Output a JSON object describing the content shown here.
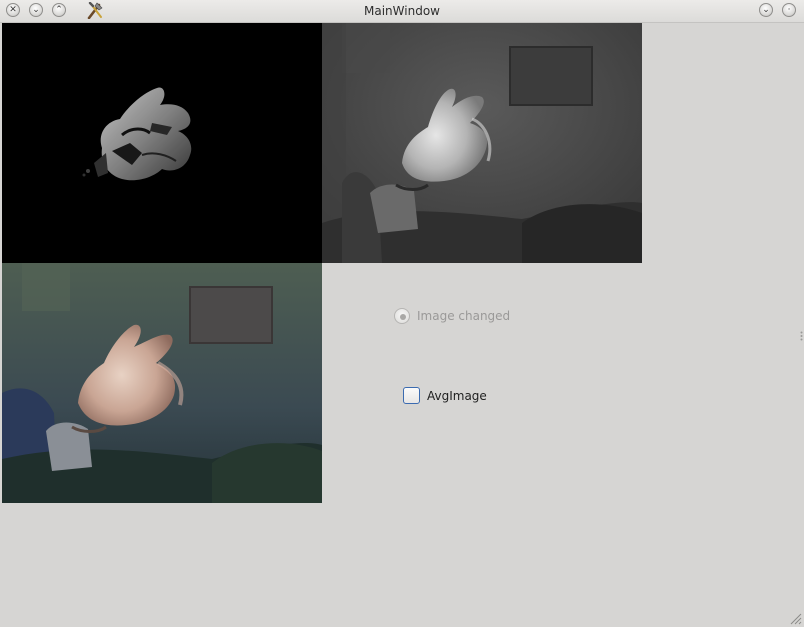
{
  "window": {
    "title": "MainWindow",
    "controls_left": [
      {
        "name": "close",
        "glyph": "✕"
      },
      {
        "name": "minimize",
        "glyph": "⌄"
      },
      {
        "name": "maximize",
        "glyph": "⌃"
      }
    ],
    "controls_right": [
      {
        "name": "shade",
        "glyph": "⌄"
      },
      {
        "name": "menu",
        "glyph": "·"
      }
    ]
  },
  "frames": [
    {
      "name": "depth-image-view",
      "kind": "depth"
    },
    {
      "name": "infrared-image-view",
      "kind": "grayscale"
    },
    {
      "name": "color-image-view",
      "kind": "color"
    }
  ],
  "controls": {
    "image_changed_label": "Image changed",
    "image_changed_checked": true,
    "image_changed_enabled": false,
    "avg_image_label": "AvgImage",
    "avg_image_checked": false
  },
  "colors": {
    "window_bg": "#d6d5d3",
    "focus_accent": "#3b6bb0"
  }
}
